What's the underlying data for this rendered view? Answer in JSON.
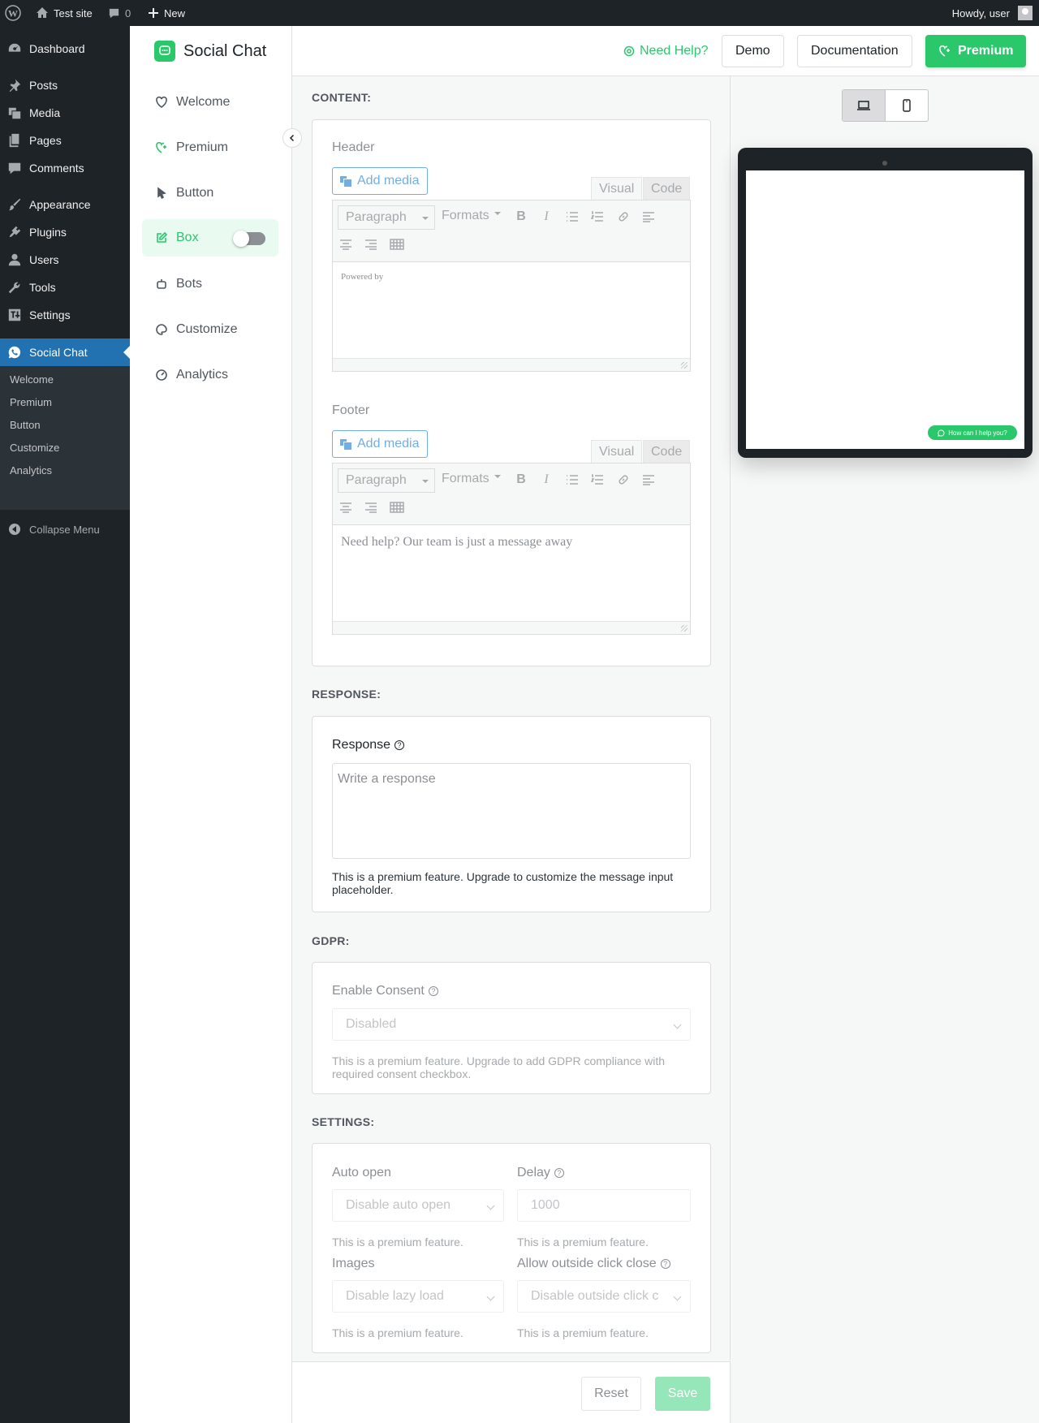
{
  "adminbar": {
    "site": "Test site",
    "comments": "0",
    "new": "New",
    "howdy": "Howdy, user"
  },
  "menu": {
    "items": [
      "Dashboard",
      "Posts",
      "Media",
      "Pages",
      "Comments",
      "Appearance",
      "Plugins",
      "Users",
      "Tools",
      "Settings",
      "Social Chat"
    ],
    "submenu": [
      "Welcome",
      "Premium",
      "Button",
      "Customize",
      "Analytics"
    ],
    "collapse": "Collapse Menu"
  },
  "plugin": {
    "brand": "Social Chat",
    "nav": [
      "Welcome",
      "Premium",
      "Button",
      "Box",
      "Bots",
      "Customize",
      "Analytics"
    ],
    "active": "Box"
  },
  "top": {
    "need_help": "Need Help?",
    "demo": "Demo",
    "docs": "Documentation",
    "premium": "Premium"
  },
  "content": {
    "title": "CONTENT:",
    "header_label": "Header",
    "footer_label": "Footer",
    "add_media": "Add media",
    "visual": "Visual",
    "code": "Code",
    "paragraph": "Paragraph",
    "formats": "Formats",
    "bold": "B",
    "italic": "I",
    "header_text": "Powered by",
    "footer_text": "Need help? Our team is just a message away"
  },
  "response": {
    "title": "RESPONSE:",
    "label": "Response",
    "placeholder": "Write a response",
    "help": "This is a premium feature. Upgrade to customize the message input placeholder."
  },
  "gdpr": {
    "title": "GDPR:",
    "label": "Enable Consent",
    "value": "Disabled",
    "help": "This is a premium feature. Upgrade to add GDPR compliance with required consent checkbox."
  },
  "settings": {
    "title": "SETTINGS:",
    "auto_open": {
      "label": "Auto open",
      "value": "Disable auto open",
      "help": "This is a premium feature."
    },
    "delay": {
      "label": "Delay",
      "placeholder": "1000",
      "help": "This is a premium feature."
    },
    "images": {
      "label": "Images",
      "value": "Disable lazy load",
      "help": "This is a premium feature."
    },
    "outside": {
      "label": "Allow outside click close",
      "value": "Disable outside click c",
      "help": "This is a premium feature."
    }
  },
  "footer": {
    "reset": "Reset",
    "save": "Save"
  },
  "preview": {
    "chat_button": "How can I help you?"
  },
  "colors": {
    "brand": "#2bc76b",
    "wp_dark": "#1d2327",
    "wp_blue": "#2271b1"
  }
}
